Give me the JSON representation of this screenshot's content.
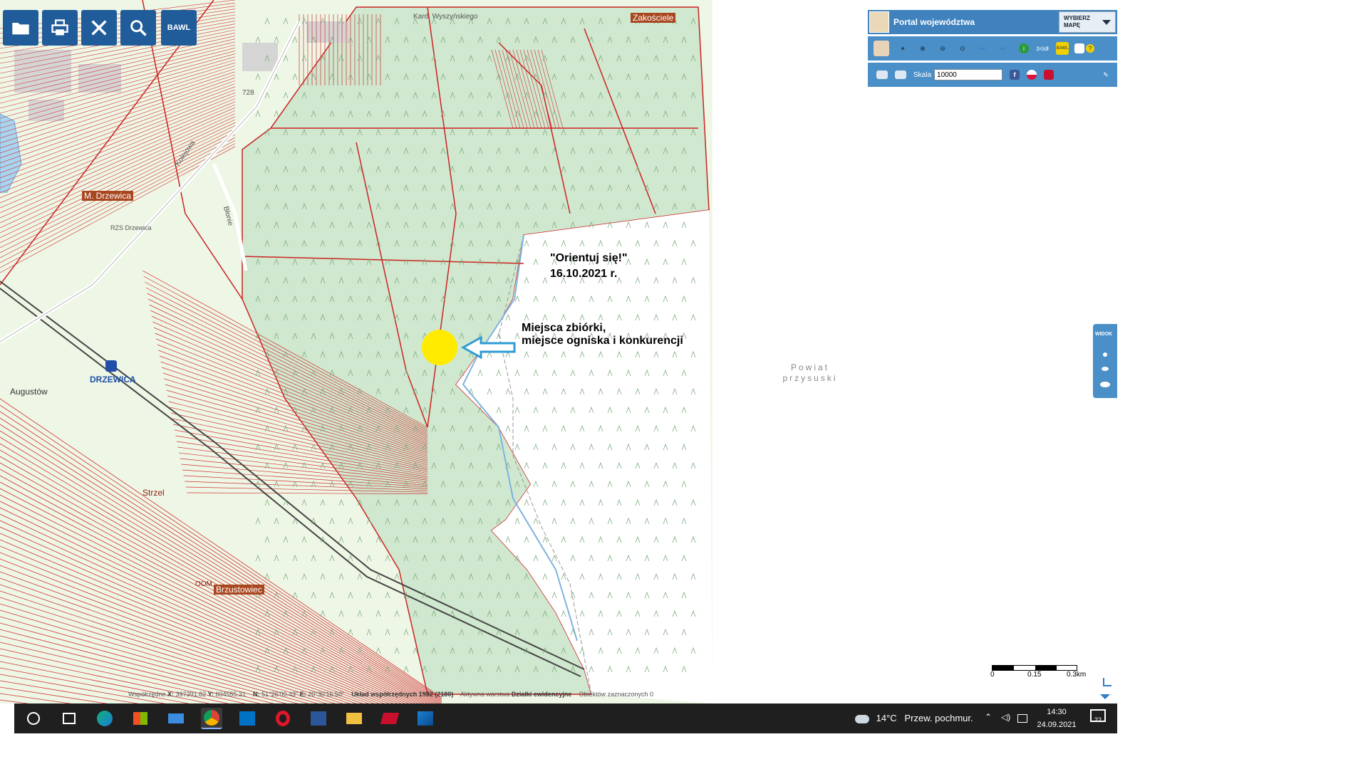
{
  "toolbar": {
    "buttons": [
      {
        "name": "folder-icon"
      },
      {
        "name": "print-icon"
      },
      {
        "name": "tools-icon"
      },
      {
        "name": "search-icon"
      }
    ],
    "bawl_label": "BAWL"
  },
  "portal": {
    "title": "Portal województwa",
    "select_label_1": "WYBIERZ",
    "select_label_2": "MAPĘ",
    "scale_label": "Skala",
    "scale_value": "10000",
    "source_icon_label": "źródł",
    "layers_icon_label": "BAWL"
  },
  "widok_label": "WIDOK",
  "annotation": {
    "title_line1": "\"Orientuj się!\"",
    "title_line2": "16.10.2021 r.",
    "meet_line1": "Miejsca zbiórki,",
    "meet_line2": "miejsce ogniska i konkurencji"
  },
  "powiat": {
    "line1": "Powiat",
    "line2": "przysuski"
  },
  "map_labels": {
    "zakoscie": "Zakościele",
    "drzewica_mala": "M. Drzewica",
    "augustow": "Augustów",
    "drzewica_station": "DRZEWICA",
    "brzustowiec": "Brzustowiec",
    "brzustowiec_prefix": "OOM",
    "strzel": "Strzel",
    "kolejowa": "Kolejowa",
    "blonie": "Błonie",
    "street_728": "728",
    "top_street": "Kard. Wyszyńskiego",
    "rural": "RZS Drzewica"
  },
  "scalebar": {
    "t0": "0",
    "t1": "0.15",
    "t2": "0.3km"
  },
  "status": {
    "coords_label": "Współrzędne",
    "x_label": "X:",
    "x_value": "397391.82",
    "y_label": "Y:",
    "y_value": "604555.31",
    "n_label": "N:",
    "n_value": "51°26'00.43\"",
    "e_label": "E:",
    "e_value": "20°30'16.50\"",
    "system_label": "Układ współrzędnych",
    "system_value": "1992 (2180)",
    "layer_label": "Aktywna warstwa",
    "layer_value": "Działki ewidencyjne",
    "selected_label": "Obiektów zaznaczonych",
    "selected_value": "0"
  },
  "taskbar": {
    "weather_temp": "14°C",
    "weather_text": "Przew. pochmur.",
    "time": "14:30",
    "date": "24.09.2021",
    "notif_count": "22",
    "apps": [
      "search-circle-icon",
      "task-view-icon",
      "edge-icon",
      "store-icon",
      "mail-icon",
      "chrome-icon",
      "outlook-icon",
      "opera-icon",
      "word-icon",
      "explorer-icon",
      "app-red-icon",
      "photos-icon"
    ]
  },
  "colors": {
    "forest": "#cfe8cf",
    "parcel": "#cc2222",
    "panel": "#4a8fc7",
    "toolbar": "#1f5c99",
    "marker": "#ffeb00",
    "arrow": "#2f9bd6"
  }
}
